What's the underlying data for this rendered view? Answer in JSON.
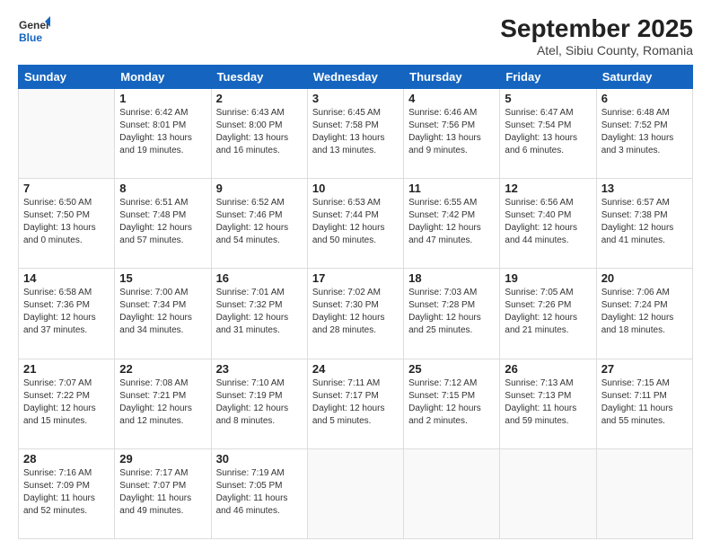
{
  "logo": {
    "general": "General",
    "blue": "Blue"
  },
  "title": "September 2025",
  "subtitle": "Atel, Sibiu County, Romania",
  "headers": [
    "Sunday",
    "Monday",
    "Tuesday",
    "Wednesday",
    "Thursday",
    "Friday",
    "Saturday"
  ],
  "weeks": [
    [
      {
        "day": "",
        "info": ""
      },
      {
        "day": "1",
        "info": "Sunrise: 6:42 AM\nSunset: 8:01 PM\nDaylight: 13 hours\nand 19 minutes."
      },
      {
        "day": "2",
        "info": "Sunrise: 6:43 AM\nSunset: 8:00 PM\nDaylight: 13 hours\nand 16 minutes."
      },
      {
        "day": "3",
        "info": "Sunrise: 6:45 AM\nSunset: 7:58 PM\nDaylight: 13 hours\nand 13 minutes."
      },
      {
        "day": "4",
        "info": "Sunrise: 6:46 AM\nSunset: 7:56 PM\nDaylight: 13 hours\nand 9 minutes."
      },
      {
        "day": "5",
        "info": "Sunrise: 6:47 AM\nSunset: 7:54 PM\nDaylight: 13 hours\nand 6 minutes."
      },
      {
        "day": "6",
        "info": "Sunrise: 6:48 AM\nSunset: 7:52 PM\nDaylight: 13 hours\nand 3 minutes."
      }
    ],
    [
      {
        "day": "7",
        "info": "Sunrise: 6:50 AM\nSunset: 7:50 PM\nDaylight: 13 hours\nand 0 minutes."
      },
      {
        "day": "8",
        "info": "Sunrise: 6:51 AM\nSunset: 7:48 PM\nDaylight: 12 hours\nand 57 minutes."
      },
      {
        "day": "9",
        "info": "Sunrise: 6:52 AM\nSunset: 7:46 PM\nDaylight: 12 hours\nand 54 minutes."
      },
      {
        "day": "10",
        "info": "Sunrise: 6:53 AM\nSunset: 7:44 PM\nDaylight: 12 hours\nand 50 minutes."
      },
      {
        "day": "11",
        "info": "Sunrise: 6:55 AM\nSunset: 7:42 PM\nDaylight: 12 hours\nand 47 minutes."
      },
      {
        "day": "12",
        "info": "Sunrise: 6:56 AM\nSunset: 7:40 PM\nDaylight: 12 hours\nand 44 minutes."
      },
      {
        "day": "13",
        "info": "Sunrise: 6:57 AM\nSunset: 7:38 PM\nDaylight: 12 hours\nand 41 minutes."
      }
    ],
    [
      {
        "day": "14",
        "info": "Sunrise: 6:58 AM\nSunset: 7:36 PM\nDaylight: 12 hours\nand 37 minutes."
      },
      {
        "day": "15",
        "info": "Sunrise: 7:00 AM\nSunset: 7:34 PM\nDaylight: 12 hours\nand 34 minutes."
      },
      {
        "day": "16",
        "info": "Sunrise: 7:01 AM\nSunset: 7:32 PM\nDaylight: 12 hours\nand 31 minutes."
      },
      {
        "day": "17",
        "info": "Sunrise: 7:02 AM\nSunset: 7:30 PM\nDaylight: 12 hours\nand 28 minutes."
      },
      {
        "day": "18",
        "info": "Sunrise: 7:03 AM\nSunset: 7:28 PM\nDaylight: 12 hours\nand 25 minutes."
      },
      {
        "day": "19",
        "info": "Sunrise: 7:05 AM\nSunset: 7:26 PM\nDaylight: 12 hours\nand 21 minutes."
      },
      {
        "day": "20",
        "info": "Sunrise: 7:06 AM\nSunset: 7:24 PM\nDaylight: 12 hours\nand 18 minutes."
      }
    ],
    [
      {
        "day": "21",
        "info": "Sunrise: 7:07 AM\nSunset: 7:22 PM\nDaylight: 12 hours\nand 15 minutes."
      },
      {
        "day": "22",
        "info": "Sunrise: 7:08 AM\nSunset: 7:21 PM\nDaylight: 12 hours\nand 12 minutes."
      },
      {
        "day": "23",
        "info": "Sunrise: 7:10 AM\nSunset: 7:19 PM\nDaylight: 12 hours\nand 8 minutes."
      },
      {
        "day": "24",
        "info": "Sunrise: 7:11 AM\nSunset: 7:17 PM\nDaylight: 12 hours\nand 5 minutes."
      },
      {
        "day": "25",
        "info": "Sunrise: 7:12 AM\nSunset: 7:15 PM\nDaylight: 12 hours\nand 2 minutes."
      },
      {
        "day": "26",
        "info": "Sunrise: 7:13 AM\nSunset: 7:13 PM\nDaylight: 11 hours\nand 59 minutes."
      },
      {
        "day": "27",
        "info": "Sunrise: 7:15 AM\nSunset: 7:11 PM\nDaylight: 11 hours\nand 55 minutes."
      }
    ],
    [
      {
        "day": "28",
        "info": "Sunrise: 7:16 AM\nSunset: 7:09 PM\nDaylight: 11 hours\nand 52 minutes."
      },
      {
        "day": "29",
        "info": "Sunrise: 7:17 AM\nSunset: 7:07 PM\nDaylight: 11 hours\nand 49 minutes."
      },
      {
        "day": "30",
        "info": "Sunrise: 7:19 AM\nSunset: 7:05 PM\nDaylight: 11 hours\nand 46 minutes."
      },
      {
        "day": "",
        "info": ""
      },
      {
        "day": "",
        "info": ""
      },
      {
        "day": "",
        "info": ""
      },
      {
        "day": "",
        "info": ""
      }
    ]
  ]
}
